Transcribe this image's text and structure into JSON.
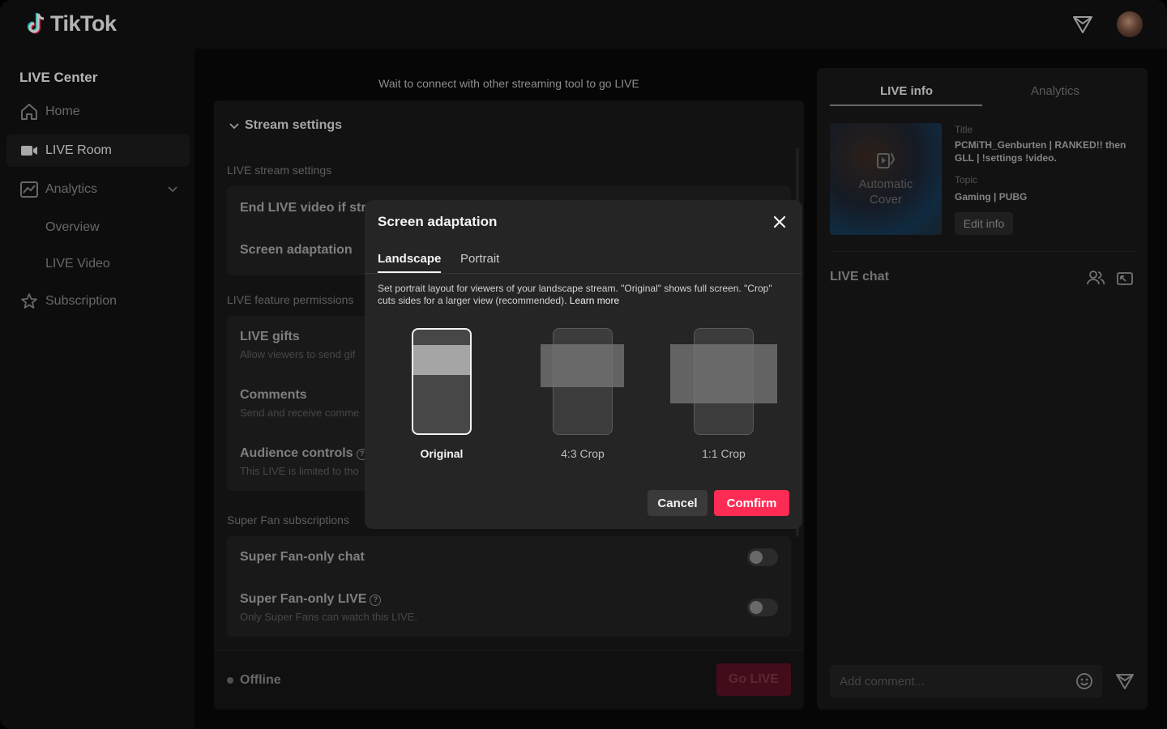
{
  "app": {
    "brand": "TikTok"
  },
  "sidebar": {
    "title": "LIVE Center",
    "items": [
      {
        "label": "Home"
      },
      {
        "label": "LIVE Room"
      },
      {
        "label": "Analytics"
      },
      {
        "label": "Overview"
      },
      {
        "label": "LIVE Video"
      },
      {
        "label": "Subscription"
      }
    ]
  },
  "main": {
    "wait_text": "Wait to connect with other streaming tool to go LIVE",
    "stream_settings": "Stream settings",
    "live_stream_settings": "LIVE stream settings",
    "end_live_label": "End LIVE video if stre",
    "screen_adaptation_label": "Screen adaptation",
    "feature_permissions": "LIVE feature permissions",
    "gifts_title": "LIVE gifts",
    "gifts_desc": "Allow viewers to send gif",
    "comments_title": "Comments",
    "comments_desc": "Send and receive comme",
    "audience_title": "Audience controls",
    "audience_desc": "This LIVE is limited to tho",
    "super_fan_section": "Super Fan subscriptions",
    "super_fan_chat": "Super Fan-only chat",
    "super_fan_live": "Super Fan-only LIVE",
    "super_fan_live_desc": "Only Super Fans can watch this LIVE.",
    "status": "Offline",
    "go_live": "Go LIVE"
  },
  "right_panel": {
    "tabs": [
      "LIVE info",
      "Analytics"
    ],
    "cover_text_line1": "Automatic",
    "cover_text_line2": "Cover",
    "title_label": "Title",
    "title_value": "PCMiTH_Genburten | RANKED!! then GLL | !settings !video.",
    "topic_label": "Topic",
    "topic_value": "Gaming | PUBG",
    "edit_info": "Edit info",
    "chat_title": "LIVE chat",
    "comment_placeholder": "Add comment..."
  },
  "modal": {
    "title": "Screen adaptation",
    "tabs": [
      "Landscape",
      "Portrait"
    ],
    "description": "Set portrait layout for viewers of your landscape stream. \"Original\" shows full screen. \"Crop\" cuts sides for a larger view (recommended).",
    "learn_more": "Learn more",
    "options": [
      {
        "label": "Original",
        "selected": true
      },
      {
        "label": "4:3 Crop",
        "selected": false
      },
      {
        "label": "1:1 Crop",
        "selected": false
      }
    ],
    "cancel": "Cancel",
    "confirm": "Comfirm"
  },
  "colors": {
    "accent": "#fe2c55",
    "background": "#121212"
  }
}
